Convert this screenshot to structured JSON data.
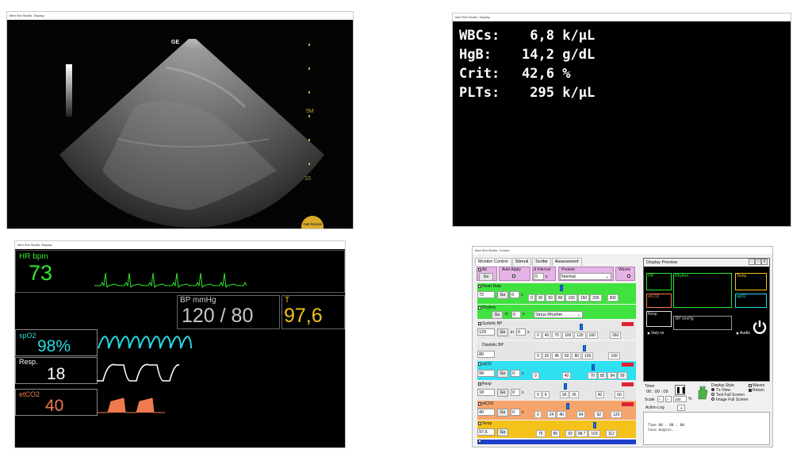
{
  "ultrasound": {
    "title": "Med Sim Studio: Display",
    "probe_marker": "GE",
    "depth_labels": [
      "5M",
      "10"
    ],
    "logo_text": "THE POCUS"
  },
  "labs": {
    "title": "Med Sim Studio: Display",
    "rows": [
      {
        "name": "WBCs:",
        "value": "6,8",
        "unit": "k/µL"
      },
      {
        "name": "HgB:",
        "value": "14,2",
        "unit": "g/dL"
      },
      {
        "name": "Crit:",
        "value": "42,6",
        "unit": "%"
      },
      {
        "name": "PLTs:",
        "value": "295",
        "unit": "k/µL"
      }
    ]
  },
  "monitor": {
    "title": "Med Sim Studio: Display",
    "hr_label": "HR  bpm",
    "hr_value": "73",
    "bp_label": "BP  mmHg",
    "bp_value": "120 / 80",
    "temp_label": "T",
    "temp_value": "97,6",
    "spo2_label": "spO2",
    "spo2_value": "98%",
    "resp_label": "Resp.",
    "resp_value": "18",
    "etco2_label": "etCO2",
    "etco2_value": "40",
    "colors": {
      "hr": "#2ee62e",
      "spo2": "#27d7e0",
      "etco2": "#f07a4f",
      "temp": "#f2c21b",
      "bp": "#d0d0d0"
    }
  },
  "control": {
    "title": "Med Sim Studio: Control",
    "tabs": [
      "Monitor Control",
      "Stimuli",
      "Scribe",
      "Assessment"
    ],
    "header": {
      "all_label": "All",
      "go": "Go",
      "auto_apply": "Auto Apply",
      "interval_label": "Δ Interval",
      "interval_value": "0",
      "interval_unit": "s",
      "presets_label": "Presets",
      "presets_value": "Normal",
      "waves_label": "Waves"
    },
    "heart_rate": {
      "label": "Heart Rate",
      "value": "72",
      "in": "0",
      "unit": "s",
      "stops": [
        "0",
        "30",
        "50",
        "80",
        "100",
        "150",
        "200",
        "300"
      ]
    },
    "rhythm": {
      "label": "Rhythm",
      "in": "0",
      "unit": "s",
      "value": "Sinus Rhythm"
    },
    "systolic": {
      "label": "Systolic BP",
      "value": "120",
      "in": "0",
      "unit": "s",
      "stops": [
        "0",
        "40",
        "70",
        "100",
        "120",
        "160",
        "260"
      ]
    },
    "diastolic": {
      "label": "Diastolic BP",
      "value": "80",
      "stops": [
        "0",
        "20",
        "45",
        "60",
        "80",
        "100",
        "160"
      ]
    },
    "spo2": {
      "label": "spO2",
      "value": "98",
      "in": "0",
      "unit": "s",
      "stops": [
        "0",
        "40",
        "70",
        "85",
        "94",
        "99"
      ]
    },
    "resp": {
      "label": "Resp",
      "value": "18",
      "in": "0",
      "unit": "s",
      "stops": [
        "0",
        "6",
        "18",
        "26",
        "42",
        "60"
      ]
    },
    "etco2": {
      "label": "etCO2",
      "value": "40",
      "in": "0",
      "unit": "s",
      "stops": [
        "0",
        "24",
        "40",
        "64",
        "92",
        "120"
      ]
    },
    "temp": {
      "label": "Temp",
      "value": "97,6",
      "stops": [
        "75",
        "85",
        "93",
        "98.7",
        "103",
        "112"
      ]
    },
    "in_word": "in",
    "preview": {
      "title": "Display Preview",
      "buttons": [
        "–",
        "□",
        "X"
      ],
      "hr": "HR",
      "rhythm": "Rhythm",
      "temp": "Temp",
      "etco2": "etCO2",
      "spo2": "spO2",
      "resp": "Resp",
      "bp": "BP  mmHg",
      "vary": "Vary vs",
      "audio": "Audio"
    },
    "timer": {
      "label": "Timer",
      "value": "00 : 00 : 09",
      "scale_label": "Scale",
      "scale_value": "100",
      "scale_unit": "%"
    },
    "display_style": {
      "label": "Display Style",
      "options": [
        "Tx-View",
        "Text Full Screen",
        "Image Full Screen"
      ],
      "waves": "Waves",
      "return": "Return"
    },
    "action_log": {
      "label": "Action Log",
      "tab": "+",
      "entries": [
        "Time 00 : 00 : 00",
        "Case begins."
      ]
    }
  }
}
